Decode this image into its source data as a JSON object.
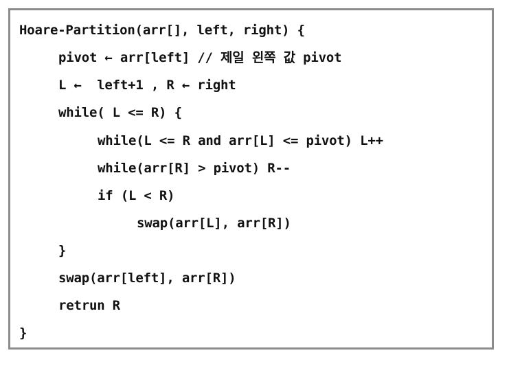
{
  "code": {
    "lines": [
      "Hoare-Partition(arr[], left, right) {",
      "pivot ← arr[left] // 제일 왼쪽 값 pivot",
      "L ←  left+1 , R ← right",
      "while( L <= R) {",
      "while(L <= R and arr[L] <= pivot) L++",
      "while(arr[R] > pivot) R--",
      "if (L < R)",
      "swap(arr[L], arr[R])",
      "}",
      "swap(arr[left], arr[R])",
      "retrun R",
      "}"
    ]
  }
}
